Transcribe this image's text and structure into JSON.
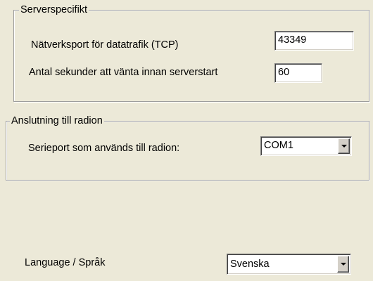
{
  "server_group": {
    "title": "Serverspecifikt",
    "port_label": "Nätverksport för datatrafik (TCP)",
    "port_value": "43349",
    "delay_label": "Antal sekunder att vänta innan serverstart",
    "delay_value": "60"
  },
  "radio_group": {
    "title": "Anslutning till radion",
    "serial_label": "Serieport som används till radion:",
    "serial_value": "COM1"
  },
  "language": {
    "label": "Language / Språk",
    "value": "Svenska"
  },
  "icons": {
    "dropdown": "chevron-down-icon"
  },
  "colors": {
    "window_bg": "#ece9d8",
    "field_bg": "#ffffff",
    "group_border": "#9d9d9d"
  }
}
